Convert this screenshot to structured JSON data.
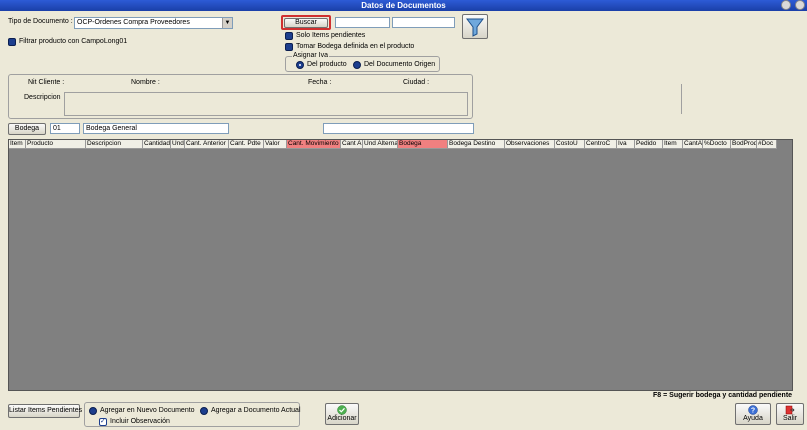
{
  "window": {
    "title": "Datos de Documentos"
  },
  "doc_type": {
    "label": "Tipo de Documento :",
    "value": "OCP-Ordenes Compra Proveedores"
  },
  "filter_checkbox": {
    "label": "Filtrar producto con CampoLong01"
  },
  "search": {
    "button_label": "Buscar",
    "from_value": "",
    "to_value": ""
  },
  "options": {
    "solo_pendientes": "Solo Items pendientes",
    "tomar_bodega": "Tomar Bodega definida en el producto"
  },
  "asignar_iva": {
    "title": "Asignar Iva",
    "opt1": "Del producto",
    "opt2": "Del Documento Origen"
  },
  "client": {
    "nit_label": "Nit Cliente :",
    "nombre_label": "Nombre :",
    "fecha_label": "Fecha :",
    "ciudad_label": "Ciudad :",
    "descripcion_label": "Descripcion"
  },
  "bodega": {
    "button_label": "Bodega",
    "code": "01",
    "name": "Bodega General"
  },
  "grid": {
    "columns": [
      {
        "label": "Item",
        "highlight": false
      },
      {
        "label": "Producto",
        "highlight": false
      },
      {
        "label": "Descripcion",
        "highlight": false
      },
      {
        "label": "Cantidad",
        "highlight": false
      },
      {
        "label": "Und",
        "highlight": false
      },
      {
        "label": "Cant. Anterior",
        "highlight": false
      },
      {
        "label": "Cant. Pdte",
        "highlight": false
      },
      {
        "label": "Valor",
        "highlight": false
      },
      {
        "label": "Cant. Movimiento",
        "highlight": true
      },
      {
        "label": "Cant A",
        "highlight": false
      },
      {
        "label": "Und Alterna",
        "highlight": false
      },
      {
        "label": "Bodega",
        "highlight": true
      },
      {
        "label": "Bodega Destino",
        "highlight": false
      },
      {
        "label": "Observaciones",
        "highlight": false
      },
      {
        "label": "CostoU",
        "highlight": false
      },
      {
        "label": "CentroC",
        "highlight": false
      },
      {
        "label": "Iva",
        "highlight": false
      },
      {
        "label": "Pedido",
        "highlight": false
      },
      {
        "label": "Item",
        "highlight": false
      },
      {
        "label": "CantA",
        "highlight": false
      },
      {
        "label": "%Docto",
        "highlight": false
      },
      {
        "label": "BodProd",
        "highlight": false
      },
      {
        "label": "#Doc",
        "highlight": false
      }
    ]
  },
  "status": {
    "hint": "F8 = Sugerir bodega y cantidad pendiente"
  },
  "bottom": {
    "listar_label": "Listar Items Pendientes",
    "agregar_nuevo": "Agregar en Nuevo Documento",
    "agregar_actual": "Agregar a Documento Actual",
    "incluir_obs": "Incluir Observación",
    "adicionar_label": "Adicionar",
    "ayuda_label": "Ayuda",
    "salir_label": "Salir"
  }
}
